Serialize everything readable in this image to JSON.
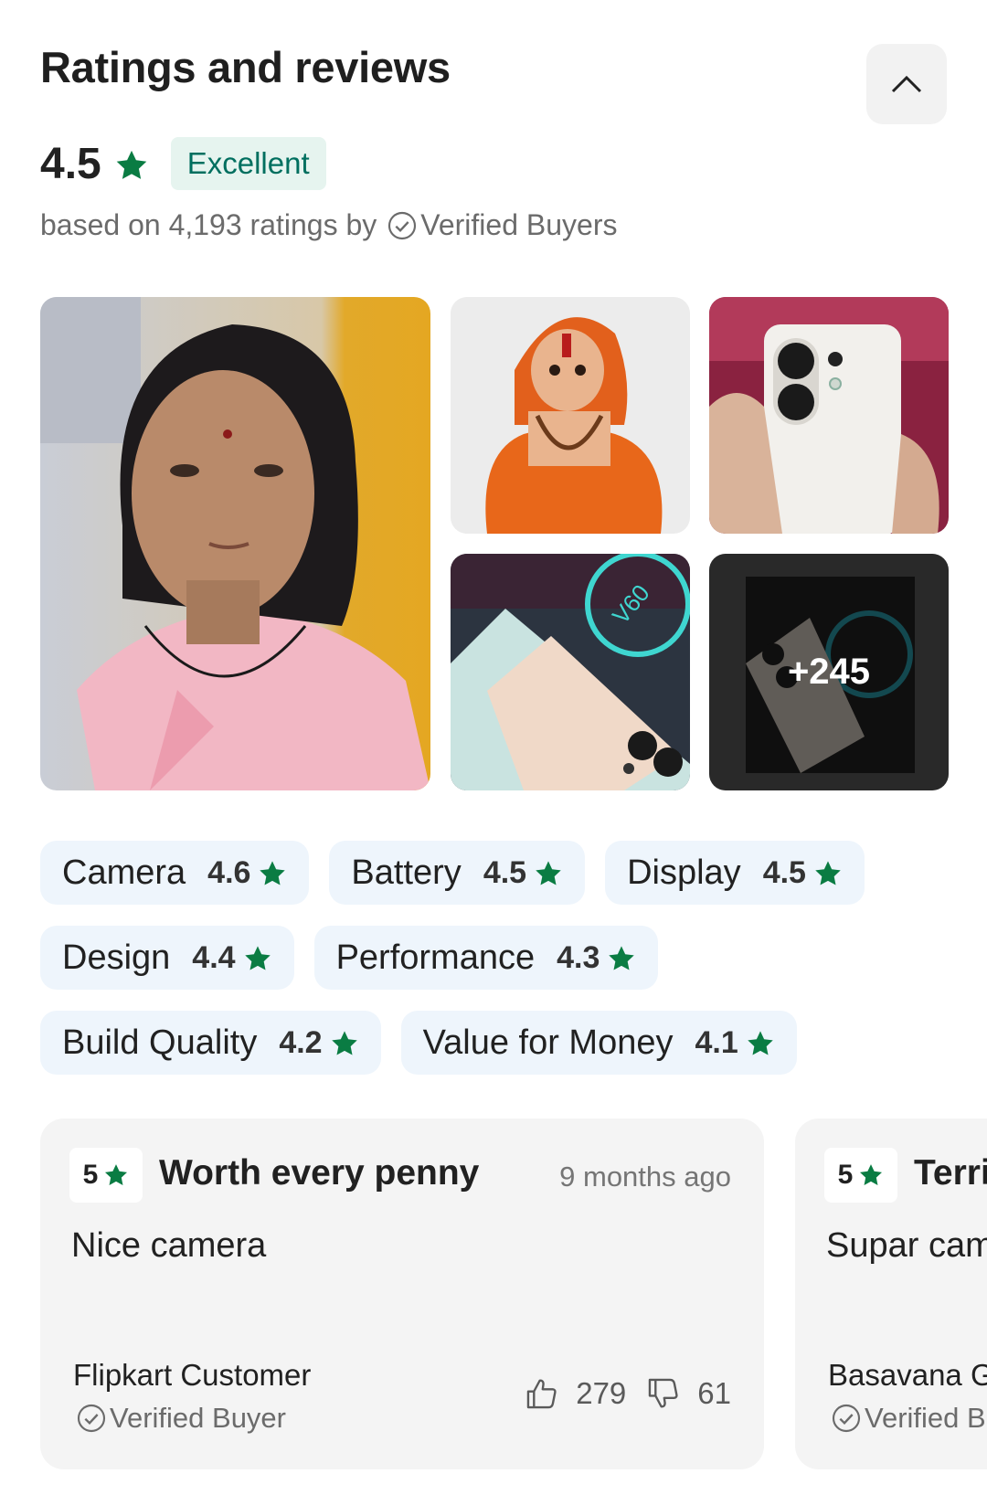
{
  "header": {
    "title": "Ratings and reviews"
  },
  "summary": {
    "rating": "4.5",
    "badge": "Excellent",
    "based_on_prefix": "based on 4,193 ratings by",
    "verified_label": "Verified Buyers"
  },
  "photos": {
    "more_count": "+245"
  },
  "aspects": [
    {
      "label": "Camera",
      "value": "4.6"
    },
    {
      "label": "Battery",
      "value": "4.5"
    },
    {
      "label": "Display",
      "value": "4.5"
    },
    {
      "label": "Design",
      "value": "4.4"
    },
    {
      "label": "Performance",
      "value": "4.3"
    },
    {
      "label": "Build Quality",
      "value": "4.2"
    },
    {
      "label": "Value for Money",
      "value": "4.1"
    }
  ],
  "reviews": [
    {
      "rating": "5",
      "title": "Worth every penny",
      "time": "9 months ago",
      "body": "Nice camera",
      "author": "Flipkart Customer",
      "verified": "Verified Buyer",
      "likes": "279",
      "dislikes": "61"
    },
    {
      "rating": "5",
      "title": "Terrific",
      "body": "Supar camera",
      "author": "Basavana G",
      "verified": "Verified Buyer"
    }
  ],
  "colors": {
    "star_green": "#0a7c43",
    "badge_bg": "#e6f4ef",
    "chip_bg": "#eef5fc"
  }
}
